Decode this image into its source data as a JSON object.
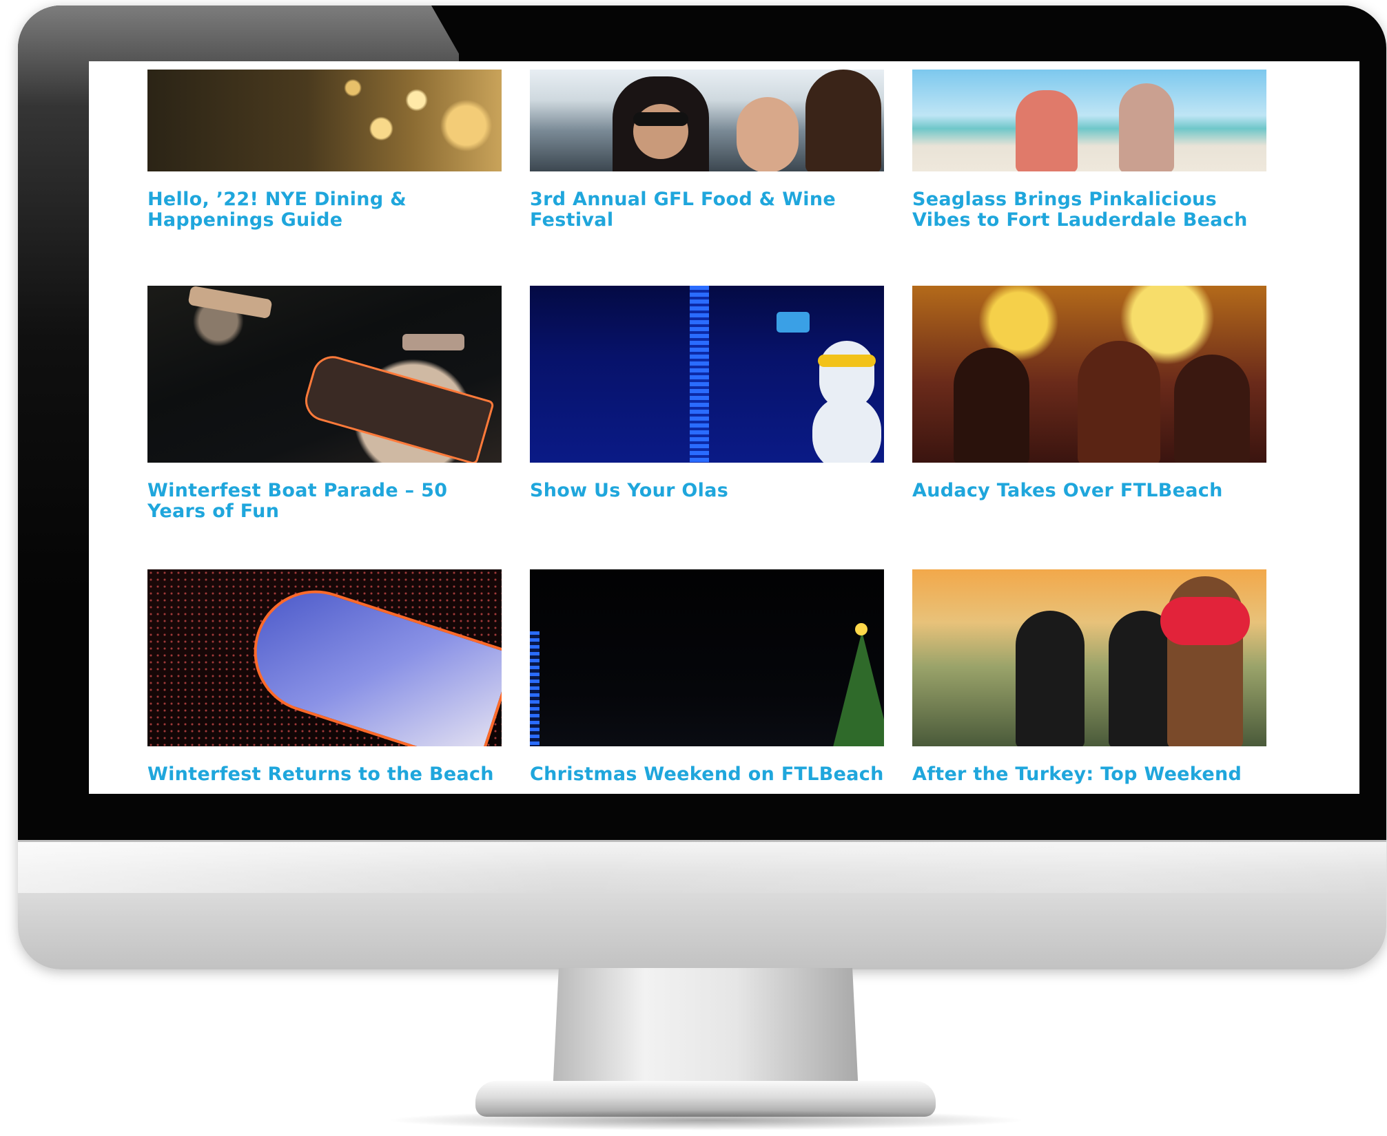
{
  "articles": [
    {
      "title": "Hello, ’22! NYE Dining & Happenings Guide",
      "image": "champagne-glasses-photo"
    },
    {
      "title": "3rd Annual GFL Food & Wine Festival",
      "image": "festival-crowd-photo"
    },
    {
      "title": "Seaglass Brings Pinkalicious Vibes to Fort Lauderdale Beach",
      "image": "beach-party-photo"
    },
    {
      "title": "Winterfest Boat Parade – 50 Years of Fun",
      "image": "boat-parade-photo"
    },
    {
      "title": "Show Us Your Olas",
      "image": "snowman-selfie-photo"
    },
    {
      "title": "Audacy Takes Over FTLBeach",
      "image": "concert-crowd-photo"
    },
    {
      "title": "Winterfest Returns to the Beach",
      "image": "aerial-boat-photo"
    },
    {
      "title": "Christmas Weekend on FTLBeach",
      "image": "christmas-tree-photo"
    },
    {
      "title": "After the Turkey: Top Weekend",
      "image": "turkey-costume-photo"
    }
  ],
  "colors": {
    "title_link": "#1fa6dc",
    "bezel": "#050505",
    "screen_background": "#ffffff"
  }
}
